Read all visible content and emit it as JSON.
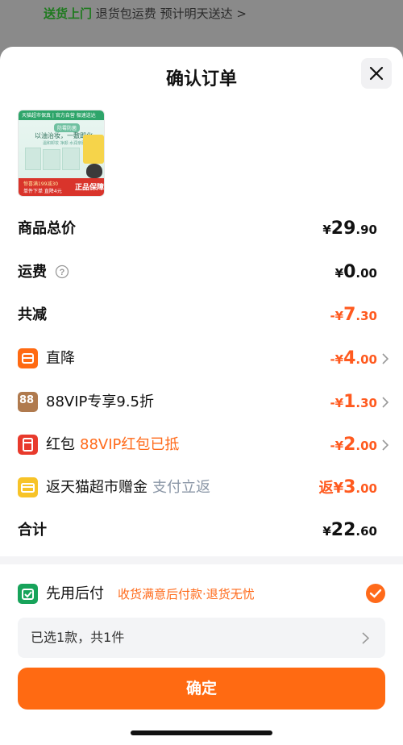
{
  "banner": {
    "delivery": "送货上门",
    "rest": "退货包运费  预计明天送达 >"
  },
  "header": {
    "title": "确认订单"
  },
  "product_image": {
    "top_strip": "天猫超市保真 | 官方自营 极速送达",
    "tag": "防霉防菌",
    "headline": "以油治妆，一敷即化",
    "subline": "温和卸妆 净颜 水润亲肤",
    "promo1": "惊喜满199减30",
    "promo2": "单件下单 直降4元",
    "badge": "正品保障"
  },
  "summary": {
    "goods_total": {
      "label": "商品总价",
      "sym": "¥",
      "int": "29",
      "dec": ".90"
    },
    "shipping": {
      "label": "运费",
      "sym": "¥",
      "int": "0",
      "dec": ".00"
    },
    "total_reduce": {
      "label": "共减",
      "sym": "-¥",
      "int": "7",
      "dec": ".30"
    },
    "direct_drop": {
      "label": "直降",
      "sym": "-¥",
      "int": "4",
      "dec": ".00"
    },
    "vip": {
      "label": "88VIP专享9.5折",
      "icon_text": "88",
      "sym": "-¥",
      "int": "1",
      "dec": ".30"
    },
    "red_packet": {
      "label": "红包",
      "note": "88VIP红包已抵",
      "sym": "-¥",
      "int": "2",
      "dec": ".00"
    },
    "cashback": {
      "label": "返天猫超市赠金",
      "note": "支付立返",
      "sym": "返¥",
      "int": "3",
      "dec": ".00"
    },
    "total": {
      "label": "合计",
      "sym": "¥",
      "int": "22",
      "dec": ".60"
    }
  },
  "pay_later": {
    "label": "先用后付",
    "note": "收货满意后付款·退货无忧",
    "checked": true
  },
  "selection": {
    "text": "已选1款，共1件"
  },
  "confirm_button": {
    "label": "确定"
  },
  "colors": {
    "accent": "#ff6a12",
    "discount": "#ff5a1f",
    "green": "#17a35a"
  },
  "icons": [
    "close-icon",
    "info-icon",
    "direct-drop-icon",
    "vip-88-icon",
    "red-packet-icon",
    "cashback-icon",
    "pay-later-icon",
    "check-icon",
    "chevron-right-icon"
  ]
}
